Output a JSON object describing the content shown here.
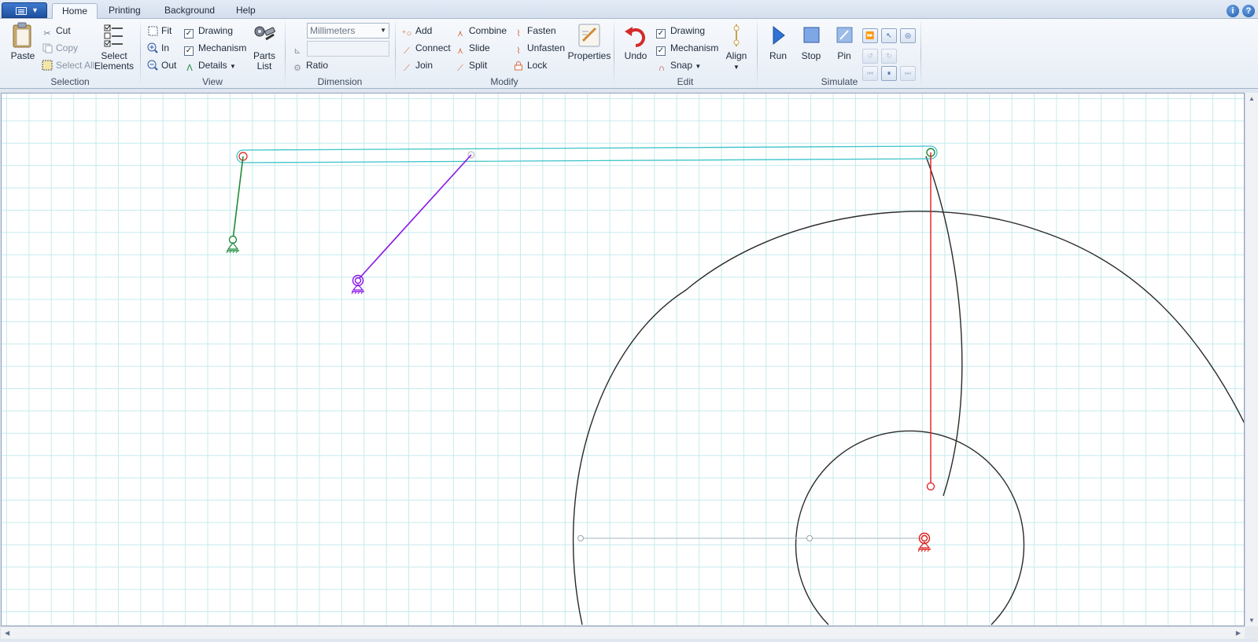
{
  "app": {
    "tabs": [
      {
        "label": "Home",
        "active": true
      },
      {
        "label": "Printing",
        "active": false
      },
      {
        "label": "Background",
        "active": false
      },
      {
        "label": "Help",
        "active": false
      }
    ],
    "help_icons": [
      "info-icon",
      "help-icon"
    ]
  },
  "ribbon": {
    "selection": {
      "label": "Selection",
      "paste": "Paste",
      "cut": "Cut",
      "copy": "Copy",
      "select_all": "Select All",
      "select_elements": [
        "Select",
        "Elements"
      ]
    },
    "view": {
      "label": "View",
      "fit": "Fit",
      "in": "In",
      "out": "Out",
      "drawing": "Drawing",
      "drawing_checked": true,
      "mechanism": "Mechanism",
      "mechanism_checked": true,
      "details": "Details",
      "parts_list": [
        "Parts",
        "List"
      ]
    },
    "dimension": {
      "label": "Dimension",
      "units_selected": "Millimeters",
      "value": "",
      "ratio": "Ratio"
    },
    "modify": {
      "label": "Modify",
      "add": "Add",
      "connect": "Connect",
      "join": "Join",
      "combine": "Combine",
      "slide": "Slide",
      "split": "Split",
      "fasten": "Fasten",
      "unfasten": "Unfasten",
      "lock": "Lock",
      "properties": "Properties"
    },
    "edit": {
      "label": "Edit",
      "undo": "Undo",
      "drawing": "Drawing",
      "drawing_checked": true,
      "mechanism": "Mechanism",
      "mechanism_checked": true,
      "snap": "Snap",
      "align": "Align"
    },
    "simulate": {
      "label": "Simulate",
      "run": "Run",
      "stop": "Stop",
      "pin": "Pin"
    }
  },
  "colors": {
    "grid": "#c5ebed",
    "coupler": "#3cc3c9",
    "green_link": "#1f8a3a",
    "purple_link": "#8a14e6",
    "red_link": "#e31b1b",
    "drawing": "#2a2a2a",
    "helper_line": "#b8c2c8"
  }
}
